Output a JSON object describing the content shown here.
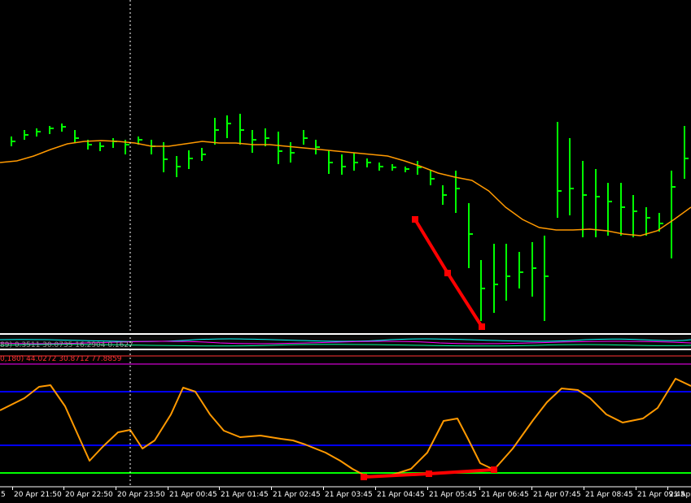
{
  "colors": {
    "background": "#000000",
    "bar": "#00ff00",
    "moving_average": "#ff9900",
    "divergence_line": "#ff0000",
    "oscillator": "#ff9900",
    "level_high": "#0000ff",
    "level_mid": "#0000ff",
    "level_low": "#00ff00",
    "crosshair": "#ffffff",
    "axis_text": "#ffffff",
    "subwindow_text": "#ff3333"
  },
  "subwindow_labels": {
    "top_indicator": "89) 0.3511 30.0735 16.2904 0.1627",
    "bottom_indicator": "0,180) 44.0272 30.8712 77.8859"
  },
  "time_axis": {
    "labels": [
      "5",
      "20 Apr 21:50",
      "20 Apr 22:50",
      "20 Apr 23:50",
      "21 Apr 00:45",
      "21 Apr 01:45",
      "21 Apr 02:45",
      "21 Apr 03:45",
      "21 Apr 04:45",
      "21 Apr 05:45",
      "21 Apr 06:45",
      "21 Apr 07:45",
      "21 Apr 08:45",
      "21 Apr 09:45",
      "21 Apr"
    ]
  },
  "chart_data": {
    "type": "line",
    "main_window": {
      "bars": [
        [
          0,
          168,
          180,
          174
        ],
        [
          1,
          160,
          172,
          166
        ],
        [
          2,
          158,
          168,
          162
        ],
        [
          3,
          155,
          165,
          158
        ],
        [
          4,
          152,
          162,
          156
        ],
        [
          5,
          160,
          176,
          170
        ],
        [
          6,
          172,
          184,
          178
        ],
        [
          7,
          175,
          186,
          180
        ],
        [
          8,
          170,
          182,
          174
        ],
        [
          9,
          172,
          190,
          178
        ],
        [
          10,
          168,
          178,
          172
        ],
        [
          11,
          172,
          190,
          180
        ],
        [
          12,
          175,
          212,
          196
        ],
        [
          13,
          192,
          218,
          205
        ],
        [
          14,
          185,
          208,
          195
        ],
        [
          15,
          182,
          198,
          190
        ],
        [
          16,
          145,
          178,
          160
        ],
        [
          17,
          142,
          170,
          152
        ],
        [
          18,
          140,
          178,
          160
        ],
        [
          19,
          160,
          188,
          172
        ],
        [
          20,
          158,
          180,
          170
        ],
        [
          21,
          162,
          202,
          186
        ],
        [
          22,
          175,
          200,
          188
        ],
        [
          23,
          160,
          178,
          170
        ],
        [
          24,
          172,
          190,
          181
        ],
        [
          25,
          185,
          214,
          200
        ],
        [
          26,
          190,
          215,
          205
        ],
        [
          27,
          188,
          210,
          200
        ],
        [
          28,
          195,
          206,
          200
        ],
        [
          29,
          200,
          210,
          205
        ],
        [
          30,
          202,
          210,
          206
        ],
        [
          31,
          205,
          212,
          208
        ],
        [
          32,
          198,
          215,
          206
        ],
        [
          33,
          210,
          228,
          220
        ],
        [
          34,
          228,
          252,
          240
        ],
        [
          35,
          210,
          262,
          232
        ],
        [
          36,
          250,
          330,
          288
        ],
        [
          37,
          320,
          395,
          355
        ],
        [
          38,
          300,
          385,
          350
        ],
        [
          39,
          300,
          370,
          340
        ],
        [
          40,
          310,
          355,
          335
        ],
        [
          41,
          298,
          365,
          330
        ],
        [
          42,
          290,
          395,
          340
        ],
        [
          43,
          150,
          268,
          235
        ],
        [
          44,
          170,
          265,
          232
        ],
        [
          45,
          198,
          292,
          240
        ],
        [
          46,
          208,
          292,
          242
        ],
        [
          47,
          225,
          290,
          248
        ],
        [
          48,
          225,
          290,
          255
        ],
        [
          49,
          240,
          292,
          260
        ],
        [
          50,
          255,
          290,
          268
        ],
        [
          51,
          262,
          285,
          275
        ],
        [
          52,
          210,
          318,
          230
        ],
        [
          53,
          155,
          220,
          195
        ]
      ],
      "moving_average_y": [
        200,
        198,
        192,
        184,
        177,
        174,
        173,
        174,
        176,
        180,
        180,
        177,
        174,
        176,
        176,
        178,
        178,
        180,
        182,
        184,
        186,
        188,
        190,
        192,
        198,
        205,
        213,
        218,
        222,
        235,
        255,
        270,
        280,
        283,
        283,
        282,
        284,
        288,
        290,
        284,
        270,
        255
      ]
    },
    "divergence_price_line": [
      [
        510,
        270
      ],
      [
        550,
        336
      ],
      [
        592,
        402
      ]
    ],
    "oscillator": {
      "levels": [
        482,
        548,
        582
      ],
      "points": [
        [
          0,
          505
        ],
        [
          30,
          490
        ],
        [
          48,
          476
        ],
        [
          62,
          474
        ],
        [
          80,
          500
        ],
        [
          110,
          567
        ],
        [
          126,
          550
        ],
        [
          145,
          532
        ],
        [
          160,
          529
        ],
        [
          175,
          552
        ],
        [
          190,
          542
        ],
        [
          210,
          510
        ],
        [
          225,
          477
        ],
        [
          240,
          482
        ],
        [
          258,
          510
        ],
        [
          275,
          530
        ],
        [
          295,
          538
        ],
        [
          320,
          536
        ],
        [
          345,
          540
        ],
        [
          360,
          542
        ],
        [
          375,
          547
        ],
        [
          400,
          557
        ],
        [
          418,
          567
        ],
        [
          433,
          577
        ],
        [
          448,
          585
        ],
        [
          462,
          587
        ],
        [
          480,
          585
        ],
        [
          505,
          577
        ],
        [
          525,
          557
        ],
        [
          545,
          518
        ],
        [
          562,
          515
        ],
        [
          575,
          540
        ],
        [
          590,
          570
        ],
        [
          607,
          578
        ],
        [
          630,
          552
        ],
        [
          655,
          517
        ],
        [
          672,
          495
        ],
        [
          690,
          478
        ],
        [
          710,
          480
        ],
        [
          725,
          490
        ],
        [
          745,
          510
        ],
        [
          765,
          520
        ],
        [
          790,
          515
        ],
        [
          808,
          502
        ],
        [
          830,
          466
        ],
        [
          849,
          475
        ]
      ]
    },
    "divergence_oscillator_line": [
      [
        447,
        587
      ],
      [
        527,
        583
      ],
      [
        607,
        578
      ]
    ]
  }
}
